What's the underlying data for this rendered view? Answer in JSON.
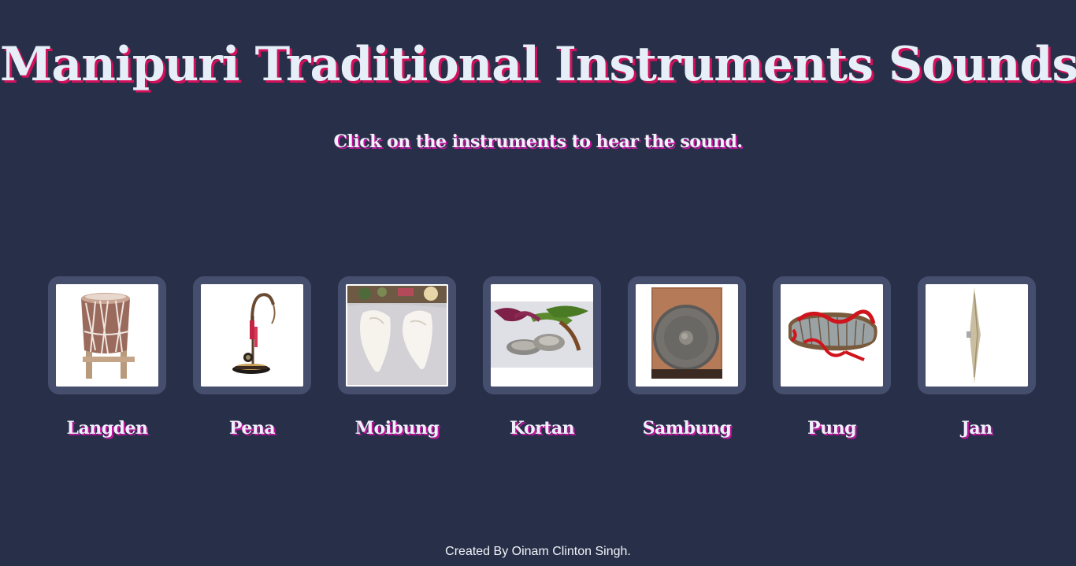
{
  "page": {
    "title": "Manipuri Traditional Instruments Sounds",
    "subtitle": "Click on the instruments to hear the sound.",
    "footer": "Created By Oinam Clinton Singh."
  },
  "instruments": [
    {
      "name": "Langden",
      "image": "langden-drum-image"
    },
    {
      "name": "Pena",
      "image": "pena-string-instrument-image"
    },
    {
      "name": "Moibung",
      "image": "moibung-conch-shell-image"
    },
    {
      "name": "Kortan",
      "image": "kortan-cymbals-image"
    },
    {
      "name": "Sambung",
      "image": "sambung-gong-image"
    },
    {
      "name": "Pung",
      "image": "pung-drum-image"
    },
    {
      "name": "Jan",
      "image": "jan-cymbal-image"
    }
  ],
  "colors": {
    "background": "#283049",
    "card": "#464e6e",
    "title_text": "#e6eef8",
    "title_shadow": "#d2105b",
    "label_shadow": "#c4149e"
  }
}
